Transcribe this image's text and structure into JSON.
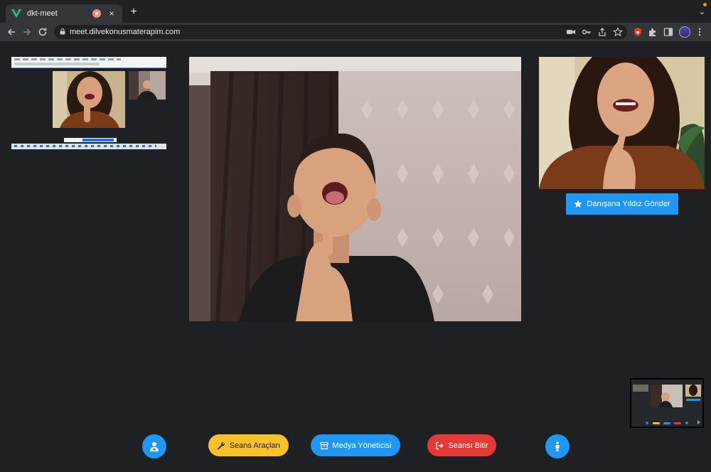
{
  "browser": {
    "tab_title": "dkt-meet",
    "tab_close": "×",
    "new_tab": "+",
    "url": "meet.dilvekonusmaterapim.com",
    "tab_menu": "⌄"
  },
  "meeting": {
    "send_star_label": "Danışana Yıldız Gönder",
    "controls": {
      "session_tools": "Seans Araçları",
      "media_manager": "Medya Yöneticisi",
      "end_session": "Seansı Bitir"
    }
  },
  "colors": {
    "primary": "#2196f3",
    "warning": "#fbc02d",
    "danger": "#e53935",
    "background": "#1f2023"
  },
  "icons": {
    "left_control": "user-profile-icon",
    "right_control": "person-standing-icon",
    "session_tools": "wrench-icon",
    "media_manager": "archive-box-icon",
    "end_session": "sign-out-icon",
    "send_star": "star-icon"
  }
}
